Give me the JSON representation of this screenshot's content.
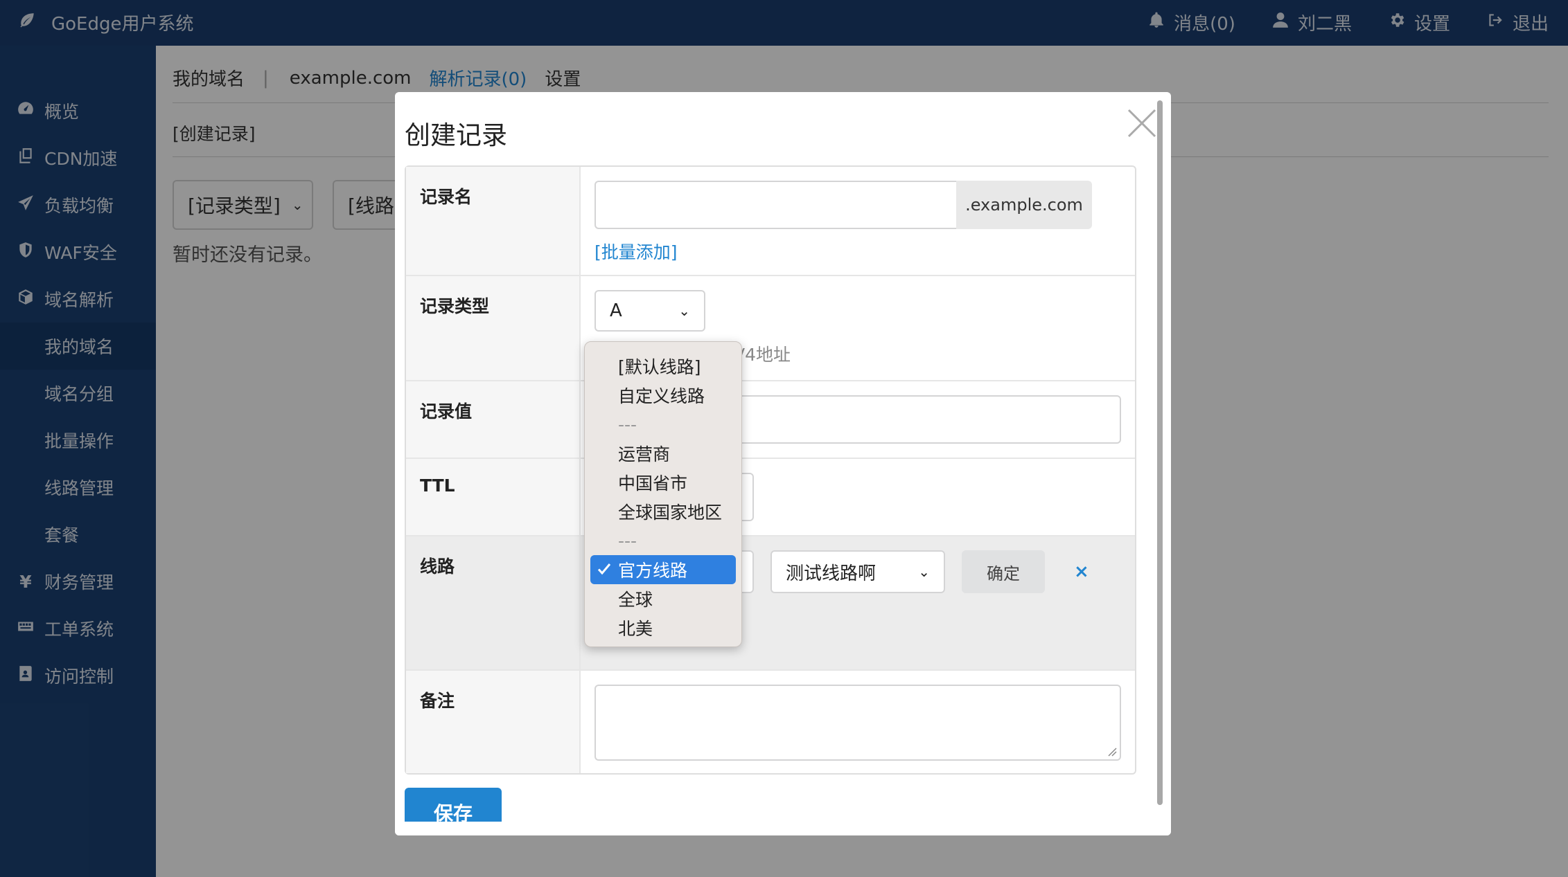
{
  "app": {
    "title": "GoEdge用户系统"
  },
  "topnav": {
    "messages": "消息(0)",
    "user": "刘二黑",
    "settings": "设置",
    "logout": "退出"
  },
  "sidebar": {
    "items": [
      {
        "label": "概览",
        "icon": "dashboard-icon"
      },
      {
        "label": "CDN加速",
        "icon": "copy-icon"
      },
      {
        "label": "负载均衡",
        "icon": "paper-plane-icon"
      },
      {
        "label": "WAF安全",
        "icon": "shield-icon"
      },
      {
        "label": "域名解析",
        "icon": "cube-icon"
      }
    ],
    "subitems": [
      "我的域名",
      "域名分组",
      "批量操作",
      "线路管理",
      "套餐"
    ],
    "items2": [
      {
        "label": "财务管理",
        "icon": "yen-icon"
      },
      {
        "label": "工单系统",
        "icon": "keyboard-icon"
      },
      {
        "label": "访问控制",
        "icon": "address-book-icon"
      }
    ]
  },
  "main": {
    "tabs": {
      "my_domains": "我的域名",
      "sep": "|",
      "domain": "example.com",
      "records": "解析记录(0)",
      "settings": "设置"
    },
    "create_link": "[创建记录]",
    "filter_type": "[记录类型]",
    "filter_route": "[线路",
    "empty_text": "暂时还没有记录。"
  },
  "modal": {
    "title": "创建记录",
    "fields": {
      "name_label": "记录名",
      "name_suffix": ".example.com",
      "batch_add": "[批量添加]",
      "type_label": "记录类型",
      "type_value": "A",
      "type_hint": "V4地址",
      "value_label": "记录值",
      "ttl_label": "TTL",
      "route_label": "线路",
      "route_second_select": "测试线路啊",
      "confirm": "确定",
      "remove": "×",
      "remark_label": "备注"
    },
    "save": "保存"
  },
  "dropdown": {
    "options": [
      "[默认线路]",
      "自定义线路",
      "---",
      "运营商",
      "中国省市",
      "全球国家地区",
      "---",
      "官方线路",
      "全球",
      "北美"
    ],
    "selected": "官方线路"
  },
  "colors": {
    "topbar": "#1a3d6e",
    "sidebar": "#1b4173",
    "primary": "#2185d0"
  }
}
